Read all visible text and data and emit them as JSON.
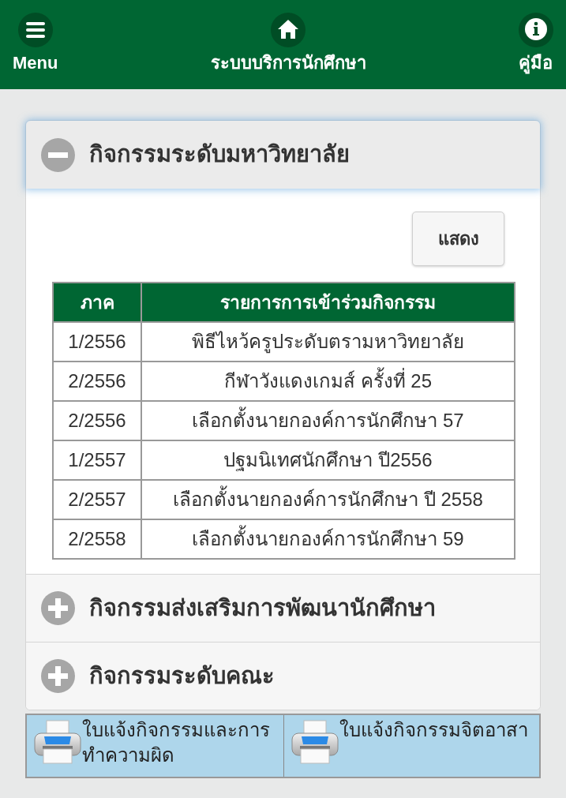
{
  "header": {
    "items": [
      {
        "kind": "menu",
        "label": "Menu"
      },
      {
        "kind": "home",
        "label": "ระบบบริการนักศึกษา"
      },
      {
        "kind": "info",
        "label": "คู่มือ"
      }
    ]
  },
  "accordion": [
    {
      "title": "กิจกรรมระดับมหาวิทยาลัย",
      "expanded": true,
      "show_button": "แสดง",
      "table": {
        "columns": [
          "ภาค",
          "รายการการเข้าร่วมกิจกรรม"
        ],
        "rows": [
          [
            "1/2556",
            "พิธีไหว้ครูประดับตรามหาวิทยาลัย"
          ],
          [
            "2/2556",
            "กีฬาวังแดงเกมส์ ครั้งที่ 25"
          ],
          [
            "2/2556",
            "เลือกตั้งนายกองค์การนักศึกษา 57"
          ],
          [
            "1/2557",
            "ปฐมนิเทศนักศึกษา ปี2556"
          ],
          [
            "2/2557",
            "เลือกตั้งนายกองค์การนักศึกษา ปี 2558"
          ],
          [
            "2/2558",
            "เลือกตั้งนายกองค์การนักศึกษา 59"
          ]
        ]
      }
    },
    {
      "title": "กิจกรรมส่งเสริมการพัฒนานักศึกษา",
      "expanded": false
    },
    {
      "title": "กิจกรรมระดับคณะ",
      "expanded": false
    }
  ],
  "print_links": [
    "ใบแจ้งกิจกรรมและการทำความผิด",
    "ใบแจ้งกิจกรรมจิตอาสา"
  ]
}
